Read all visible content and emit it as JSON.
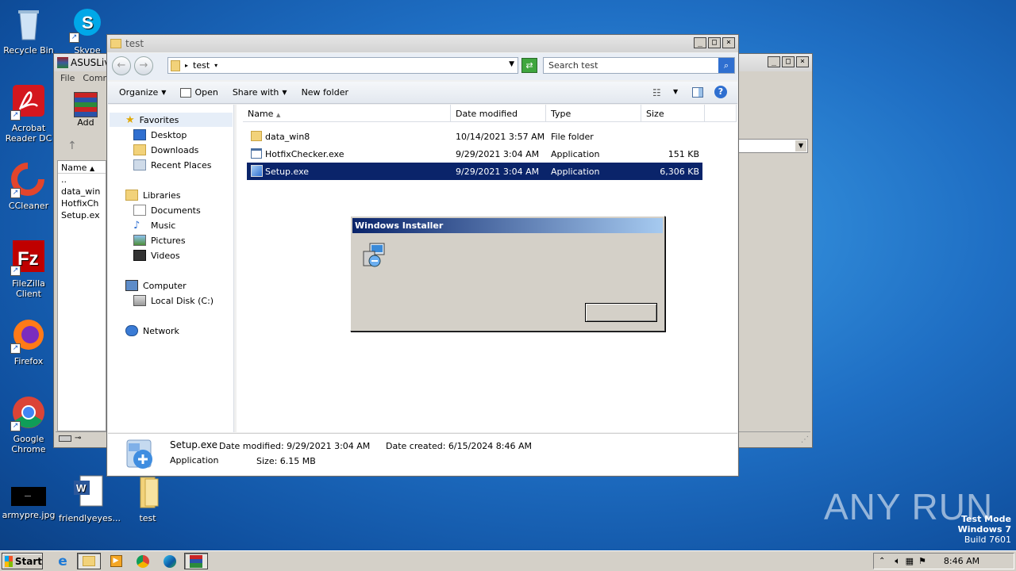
{
  "desktop": {
    "icons": [
      {
        "label": "Recycle Bin"
      },
      {
        "label": "Skype"
      },
      {
        "label": "Acrobat Reader DC"
      },
      {
        "label": "CCleaner"
      },
      {
        "label": "FileZilla Client"
      },
      {
        "label": "Firefox"
      },
      {
        "label": "Google Chrome"
      },
      {
        "label": "armypre.jpg"
      },
      {
        "label": "friendlyeyes..."
      },
      {
        "label": "test"
      }
    ],
    "watermark": "ANY RUN",
    "test_mode": {
      "line1": "Test Mode",
      "line2": "Windows 7",
      "line3": "Build 7601"
    }
  },
  "back_window": {
    "title": "ASUSLiv",
    "menu": [
      "File",
      "Comm"
    ],
    "add_label": "Add",
    "name_col": "Name",
    "rows": [
      "..",
      "data_win",
      "HotfixCh",
      "Setup.ex"
    ]
  },
  "explorer": {
    "title": "test",
    "breadcrumb": "test",
    "search_placeholder": "Search test",
    "toolbar": {
      "organize": "Organize",
      "open": "Open",
      "share_with": "Share with",
      "new_folder": "New folder"
    },
    "nav": {
      "favorites": "Favorites",
      "desktop": "Desktop",
      "downloads": "Downloads",
      "recent_places": "Recent Places",
      "libraries": "Libraries",
      "documents": "Documents",
      "music": "Music",
      "pictures": "Pictures",
      "videos": "Videos",
      "computer": "Computer",
      "local_disk": "Local Disk (C:)",
      "network": "Network"
    },
    "columns": {
      "name": "Name",
      "date_modified": "Date modified",
      "type": "Type",
      "size": "Size"
    },
    "files": [
      {
        "name": "data_win8",
        "date": "10/14/2021 3:57 AM",
        "type": "File folder",
        "size": ""
      },
      {
        "name": "HotfixChecker.exe",
        "date": "9/29/2021 3:04 AM",
        "type": "Application",
        "size": "151 KB"
      },
      {
        "name": "Setup.exe",
        "date": "9/29/2021 3:04 AM",
        "type": "Application",
        "size": "6,306 KB"
      }
    ],
    "details": {
      "name": "Setup.exe",
      "type": "Application",
      "date_modified_label": "Date modified:",
      "date_modified": "9/29/2021 3:04 AM",
      "size_label": "Size:",
      "size": "6.15 MB",
      "date_created_label": "Date created:",
      "date_created": "6/15/2024 8:46 AM"
    }
  },
  "dialog": {
    "title": "Windows Installer",
    "button_label": ""
  },
  "taskbar": {
    "start": "Start",
    "clock": "8:46 AM"
  }
}
